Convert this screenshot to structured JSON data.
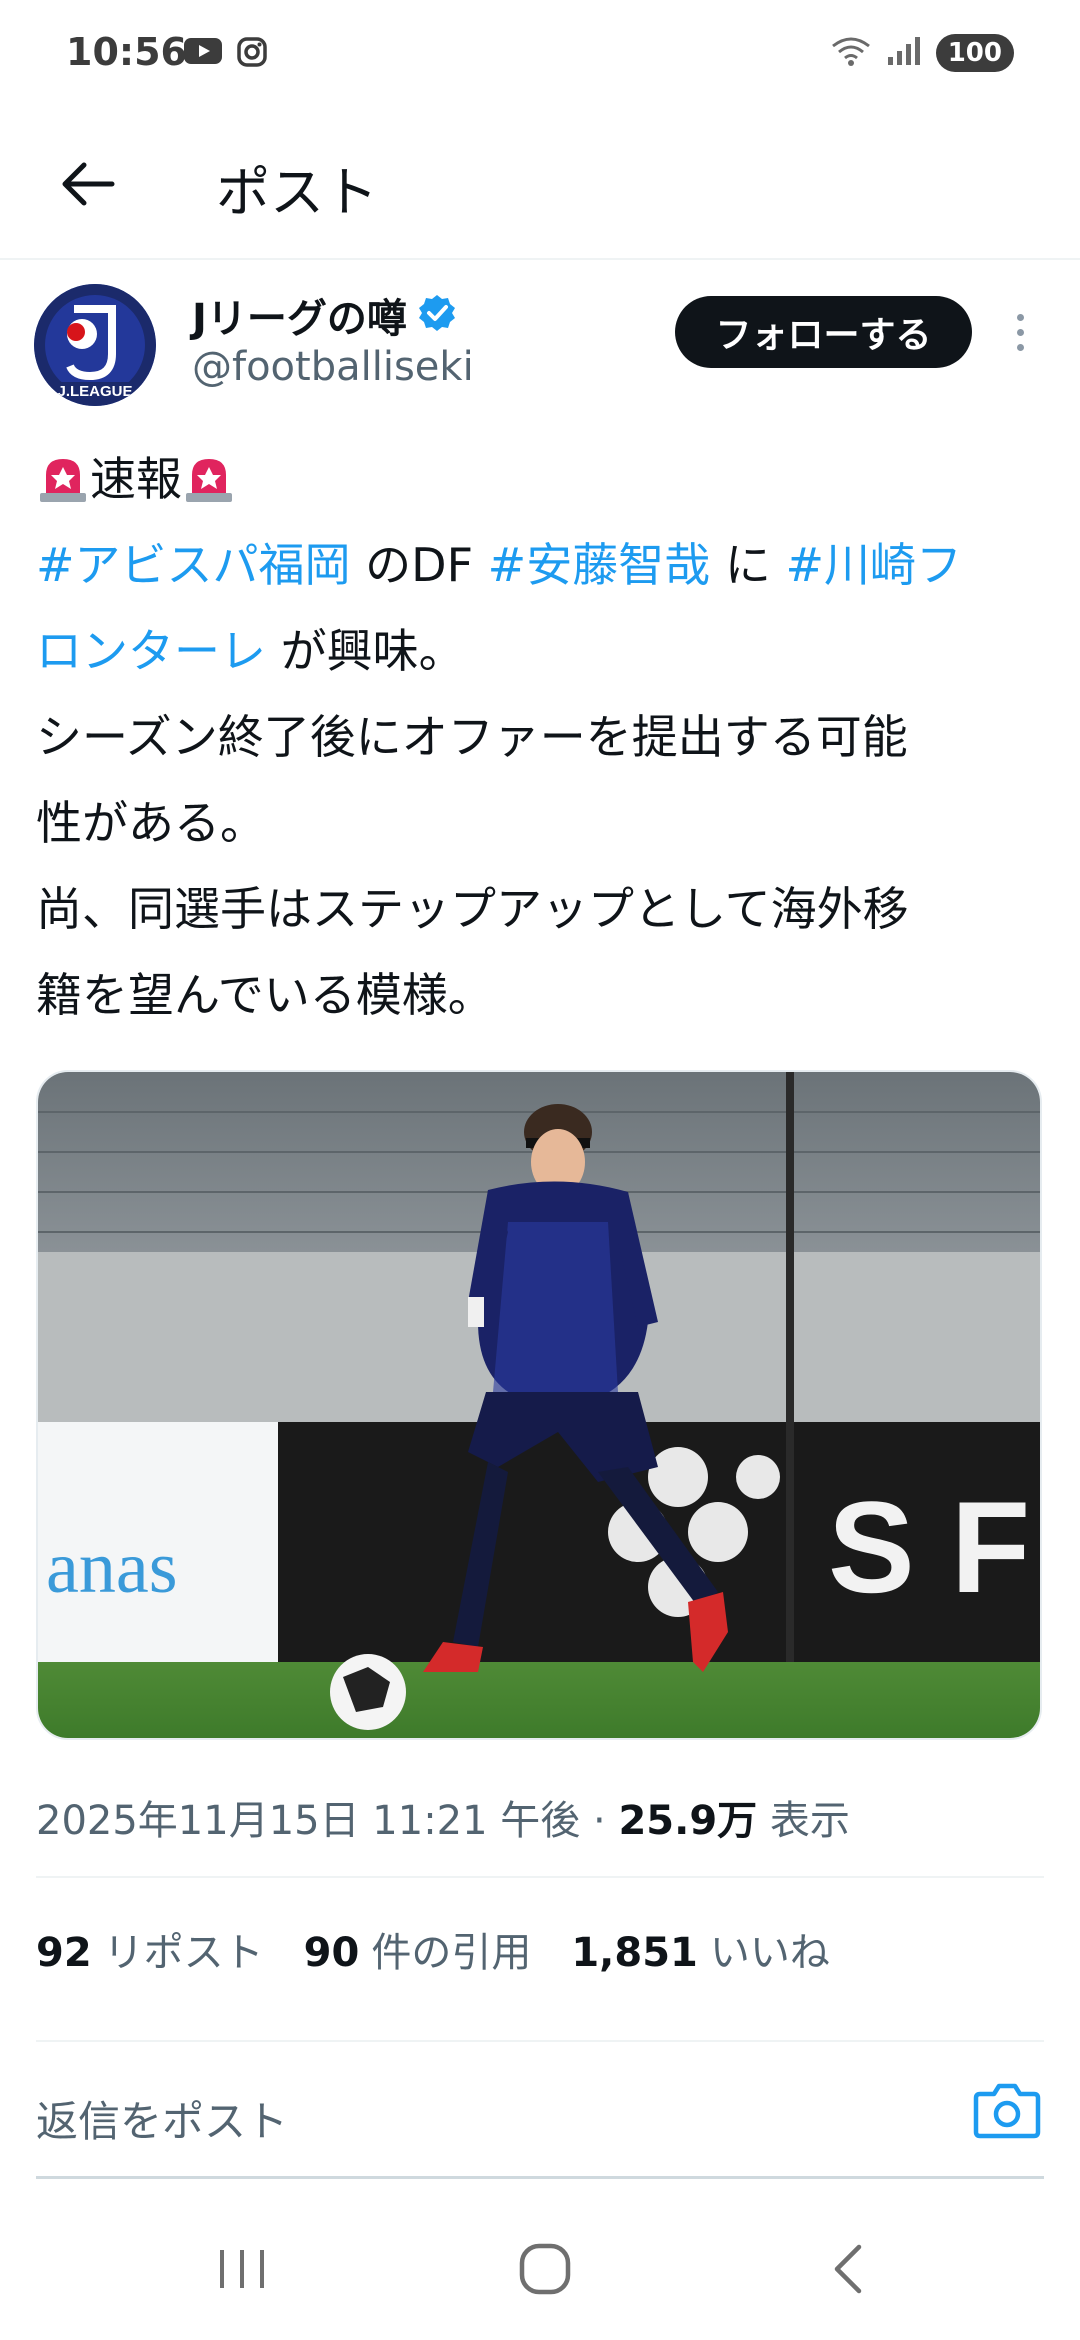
{
  "status_bar": {
    "time": "10:56",
    "battery": "100",
    "app_icons": [
      "youtube-icon",
      "instagram-icon"
    ],
    "right_icons": [
      "wifi-icon",
      "signal-icon"
    ]
  },
  "header": {
    "title": "ポスト",
    "back_icon": "back-arrow-icon"
  },
  "author": {
    "display_name": "Jリーグの噂",
    "handle": "@footballiseki",
    "verified": true,
    "follow_label": "フォローする",
    "avatar_logo_text": "J.LEAGUE"
  },
  "tweet": {
    "headline": "速報",
    "hashtags": [
      "#アビスパ福岡",
      "#安藤智哉",
      "#川崎フ",
      "ロンターレ"
    ],
    "text_parts": {
      "no_df": " のDF ",
      "ni": " に ",
      "ga_kyomi": " が興味。"
    },
    "lines": [
      "シーズン終了後にオファーを提出する可能",
      "性がある。",
      "尚、同選手はステップアップとして海外移",
      "籍を望んでいる模様。"
    ],
    "image_banner_texts": [
      "anas",
      "S F"
    ]
  },
  "meta": {
    "datetime": "2025年11月15日 11:21 午後 · ",
    "views_count": "25.9万",
    "views_label": " 表示"
  },
  "stats": {
    "reposts_count": "92",
    "reposts_label": "リポスト",
    "quotes_count": "90",
    "quotes_label": "件の引用",
    "likes_count": "1,851",
    "likes_label": "いいね"
  },
  "reply": {
    "placeholder": "返信をポスト",
    "camera_icon": "camera-icon"
  },
  "nav": {
    "items": [
      "recent-apps-icon",
      "home-icon",
      "back-icon"
    ]
  },
  "colors": {
    "link": "#1d9bf0",
    "text": "#0f1419",
    "secondary": "#536471",
    "siren": "#e0245e"
  }
}
